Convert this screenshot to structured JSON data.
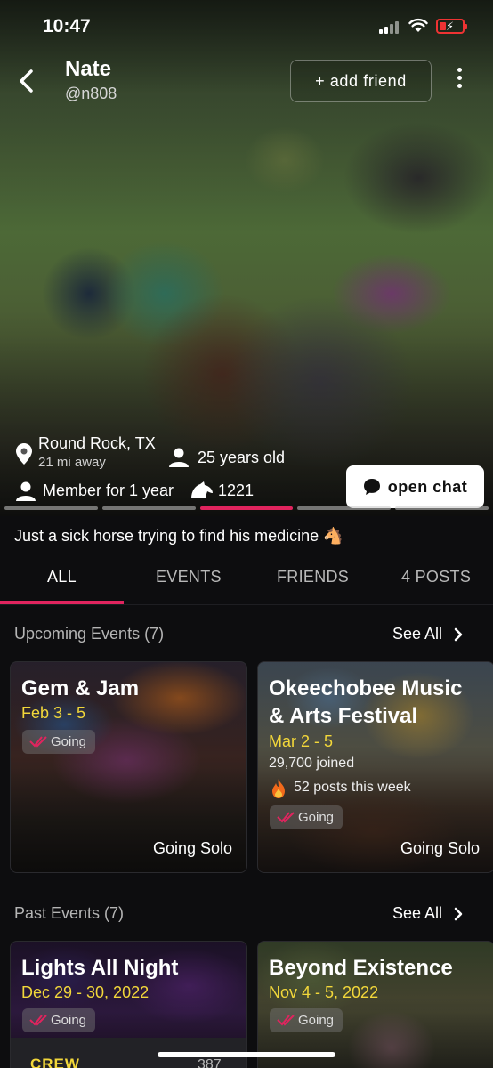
{
  "status_bar": {
    "time": "10:47"
  },
  "profile": {
    "name": "Nate",
    "handle": "@n808",
    "add_friend_label": "+ add friend",
    "location_city": "Round Rock, TX",
    "location_distance": "21 mi away",
    "age": "25 years old",
    "member_since": "Member for 1 year",
    "horse_count": "1221",
    "open_chat_label": "open chat",
    "bio": "Just a sick horse trying to find his medicine 🐴"
  },
  "tabs": [
    {
      "label": "ALL",
      "active": true
    },
    {
      "label": "EVENTS",
      "active": false
    },
    {
      "label": "FRIENDS",
      "active": false
    },
    {
      "label": "4 POSTS",
      "active": false
    }
  ],
  "upcoming": {
    "title": "Upcoming Events (7)",
    "see_all": "See All",
    "events": [
      {
        "title": "Gem & Jam",
        "date": "Feb 3 - 5",
        "status": "Going",
        "tag": "Going Solo"
      },
      {
        "title_line1": "Okeechobee Music",
        "title_line2": "& Arts Festival",
        "date": "Mar 2 - 5",
        "joined": "29,700 joined",
        "posts": "52 posts this week",
        "status": "Going",
        "tag": "Going Solo"
      }
    ]
  },
  "past": {
    "title": "Past Events (7)",
    "see_all": "See All",
    "events": [
      {
        "title": "Lights All Night",
        "date": "Dec 29 - 30, 2022",
        "status": "Going",
        "extra_label": "CREW",
        "extra_count": "387"
      },
      {
        "title": "Beyond Existence",
        "date": "Nov 4 - 5, 2022",
        "status": "Going"
      }
    ]
  },
  "colors": {
    "accent": "#e0245e",
    "date_yellow": "#f2d73a",
    "background": "#0d0d0f"
  },
  "icons": [
    "back-chevron-icon",
    "more-vertical-icon",
    "location-pin-icon",
    "user-icon",
    "horse-icon",
    "chat-bubble-icon",
    "checkmark-icon",
    "chevron-right-icon",
    "fire-icon"
  ]
}
